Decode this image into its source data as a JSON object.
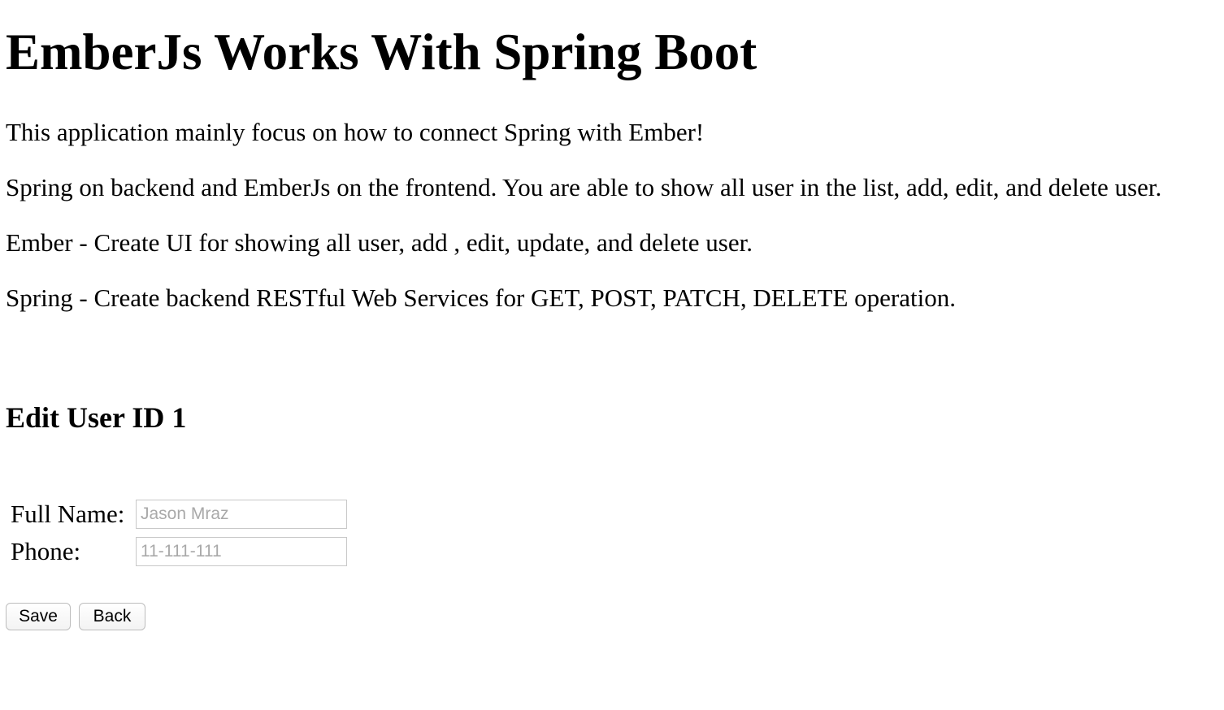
{
  "header": {
    "title": "EmberJs Works With Spring Boot"
  },
  "intro": {
    "paragraphs": [
      "This application mainly focus on how to connect Spring with Ember!",
      "Spring on backend and EmberJs on the frontend. You are able to show all user in the list, add, edit, and delete user.",
      "Ember - Create UI for showing all user, add , edit, update, and delete user.",
      "Spring - Create backend RESTful Web Services for GET, POST, PATCH, DELETE operation."
    ]
  },
  "edit_form": {
    "heading": "Edit User ID 1",
    "full_name": {
      "label": "Full Name:",
      "value": "",
      "placeholder": "Jason Mraz"
    },
    "phone": {
      "label": "Phone:",
      "value": "",
      "placeholder": "11-111-111"
    },
    "save_label": "Save",
    "back_label": "Back"
  }
}
